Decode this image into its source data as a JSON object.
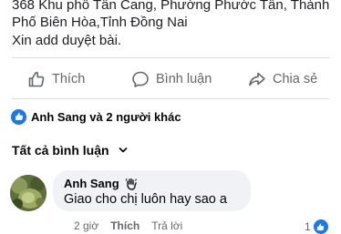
{
  "post": {
    "line1": "368 Khu phố Tân Cang, Phường Phước Tân, Thành",
    "line2": "Phố Biên Hòa,Tỉnh Đồng Nai",
    "line3": "Xin add duyệt bài."
  },
  "actions": {
    "like_label": "Thích",
    "comment_label": "Bình luận",
    "share_label": "Chia sẻ"
  },
  "reactions": {
    "summary": "Anh Sang và 2 người khác"
  },
  "comments_filter": {
    "label": "Tất cả bình luận"
  },
  "comment": {
    "author": "Anh Sang",
    "text": "Giao cho chị luôn hay sao a",
    "time": "2 giờ",
    "like_label": "Thích",
    "reply_label": "Trả lời",
    "reaction_count": "1"
  },
  "colors": {
    "accent": "#1877f2",
    "secondary_text": "#65676b",
    "bubble_bg": "#f0f2f5"
  },
  "icons": [
    "thumbs-up-icon",
    "comment-bubble-icon",
    "share-arrow-icon",
    "like-badge-icon",
    "chevron-down-icon",
    "waving-hand-icon"
  ]
}
